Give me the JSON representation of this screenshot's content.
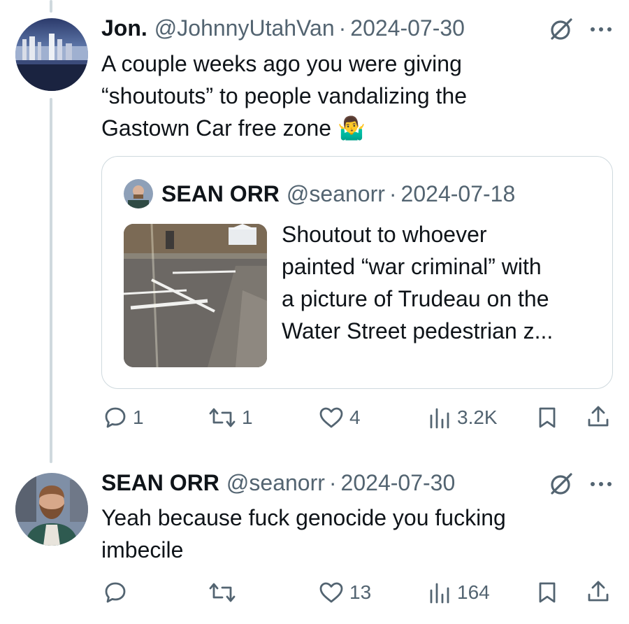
{
  "tweets": [
    {
      "name": "Jon.",
      "handle": "@JohnnyUtahVan",
      "separator": "·",
      "date": "2024-07-30",
      "text_lines": [
        "A couple weeks ago you were giving",
        "“shoutouts” to people vandalizing the",
        "Gastown Car free zone 🤷‍♂️"
      ],
      "quote": {
        "name": "SEAN ORR",
        "handle": "@seanorr",
        "separator": "·",
        "date": "2024-07-18",
        "text_lines": [
          "Shoutout to whoever",
          "painted “war criminal” with",
          "a picture of Trudeau on the",
          "Water Street pedestrian z..."
        ]
      },
      "actions": {
        "replies": "1",
        "reposts": "1",
        "likes": "4",
        "views": "3.2K"
      }
    },
    {
      "name": "SEAN ORR",
      "handle": "@seanorr",
      "separator": "·",
      "date": "2024-07-30",
      "text_lines": [
        "Yeah because fuck genocide you fucking",
        "imbecile"
      ],
      "actions": {
        "replies": "",
        "reposts": "",
        "likes": "13",
        "views": "164"
      }
    }
  ],
  "colors": {
    "text": "#0f1419",
    "muted": "#536471",
    "border": "#cfd9de",
    "thread_line": "#cfd9de"
  },
  "icons": [
    "grok-icon",
    "more-icon",
    "reply-icon",
    "repost-icon",
    "like-icon",
    "views-icon",
    "bookmark-icon",
    "share-icon"
  ]
}
